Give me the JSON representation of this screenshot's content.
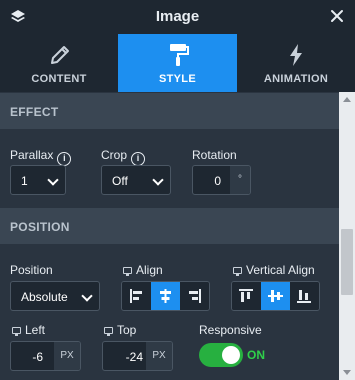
{
  "header": {
    "title": "Image",
    "layers_icon": "layers-icon",
    "close_icon": "close-icon"
  },
  "tabs": [
    {
      "label": "CONTENT",
      "icon": "pencil-icon"
    },
    {
      "label": "STYLE",
      "icon": "paint-roller-icon",
      "active": true
    },
    {
      "label": "ANIMATION",
      "icon": "lightning-icon"
    }
  ],
  "effect": {
    "heading": "EFFECT",
    "parallax": {
      "label": "Parallax",
      "value": "1"
    },
    "crop": {
      "label": "Crop",
      "value": "Off"
    },
    "rotation": {
      "label": "Rotation",
      "value": "0",
      "unit": "°"
    }
  },
  "position": {
    "heading": "POSITION",
    "position": {
      "label": "Position",
      "value": "Absolute"
    },
    "align": {
      "label": "Align",
      "options": [
        "align-left-icon",
        "align-center-icon",
        "align-right-icon"
      ],
      "selected": 1
    },
    "valign": {
      "label": "Vertical Align",
      "options": [
        "align-top-icon",
        "align-middle-icon",
        "align-bottom-icon"
      ],
      "selected": 1
    },
    "left": {
      "label": "Left",
      "value": "-6",
      "unit": "PX"
    },
    "top": {
      "label": "Top",
      "value": "-24",
      "unit": "PX"
    },
    "responsive": {
      "label": "Responsive",
      "state": "ON",
      "on": true
    }
  },
  "colors": {
    "accent": "#1d8ff0",
    "panel": "#2a3440",
    "toggle_on": "#27b040"
  }
}
